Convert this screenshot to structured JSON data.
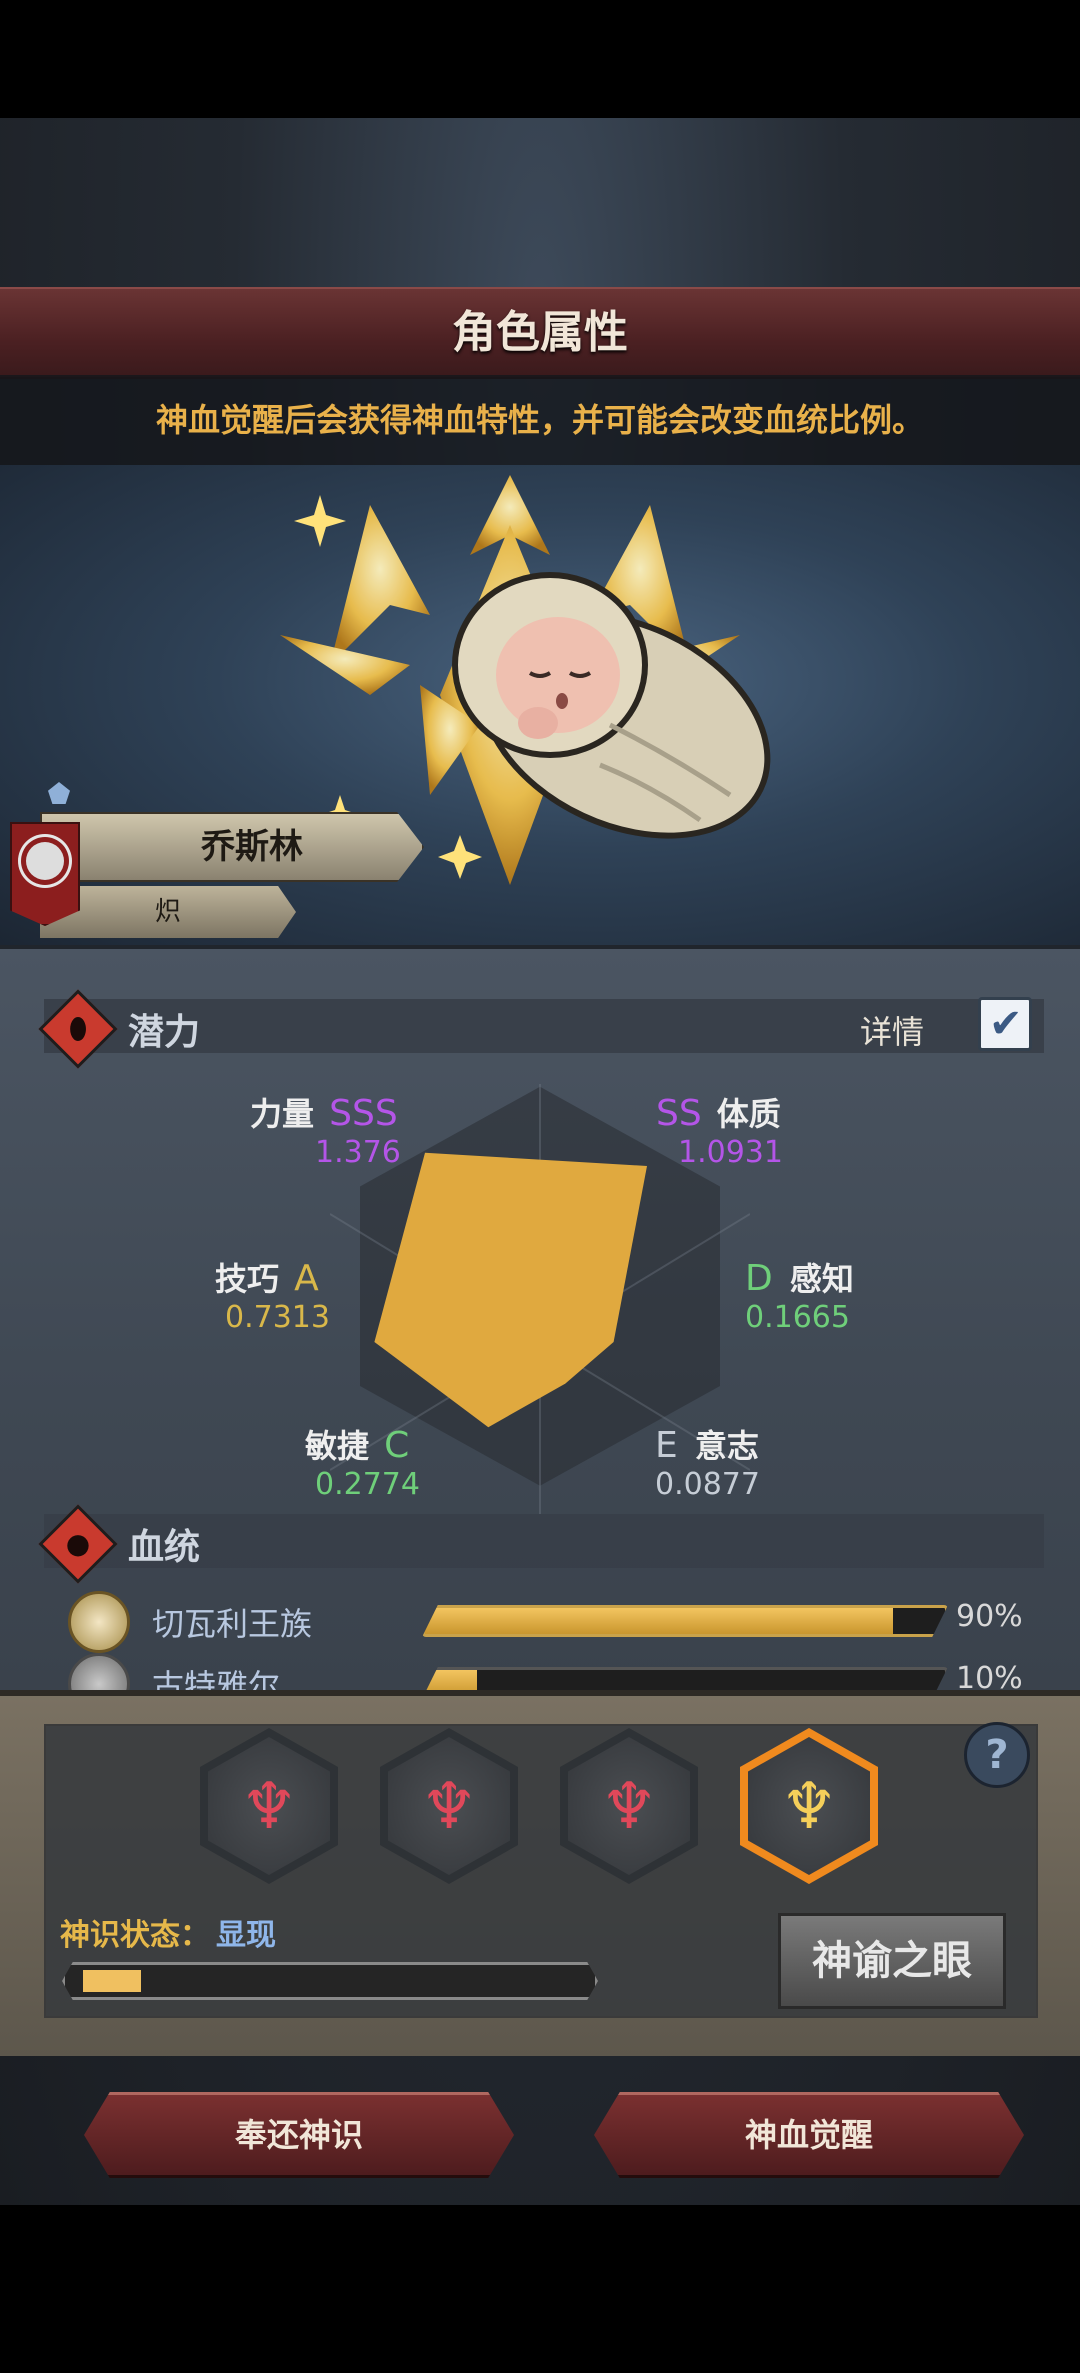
{
  "header": {
    "title": "角色属性",
    "subtitle": "神血觉醒后会获得神血特性，并可能会改变血统比例。"
  },
  "character": {
    "name": "乔斯林",
    "sub_label": "炽"
  },
  "potential": {
    "section_label": "潜力",
    "detail_label": "详情",
    "detail_checked": true,
    "stats": [
      {
        "name": "力量",
        "grade": "SSS",
        "value": "1.376",
        "color": "#b455e8"
      },
      {
        "name": "体质",
        "grade": "SS",
        "value": "1.0931",
        "color": "#b455e8"
      },
      {
        "name": "感知",
        "grade": "D",
        "value": "0.1665",
        "color": "#6fcf7a"
      },
      {
        "name": "意志",
        "grade": "E",
        "value": "0.0877",
        "color": "#c6cdd6"
      },
      {
        "name": "敏捷",
        "grade": "C",
        "value": "0.2774",
        "color": "#6fcf7a"
      },
      {
        "name": "技巧",
        "grade": "A",
        "value": "0.7313",
        "color": "#d9b84a"
      }
    ]
  },
  "bloodline": {
    "section_label": "血统",
    "items": [
      {
        "name": "切瓦利王族",
        "percent": "90%",
        "fill": 0.9
      },
      {
        "name": "古特雅尔",
        "percent": "10%",
        "fill": 0.1
      }
    ]
  },
  "divine_sense": {
    "status_label": "神识状态：",
    "status_value": "显现",
    "progress": 0.12,
    "oracle_button": "神谕之眼",
    "slots": [
      {
        "state": "red"
      },
      {
        "state": "red"
      },
      {
        "state": "red"
      },
      {
        "state": "gold-active"
      }
    ]
  },
  "actions": {
    "return_label": "奉还神识",
    "awaken_label": "神血觉醒"
  },
  "colors": {
    "accent_gold": "#e9b14a",
    "title_red": "#6a3434",
    "radar_fill": "#e0a93f"
  }
}
